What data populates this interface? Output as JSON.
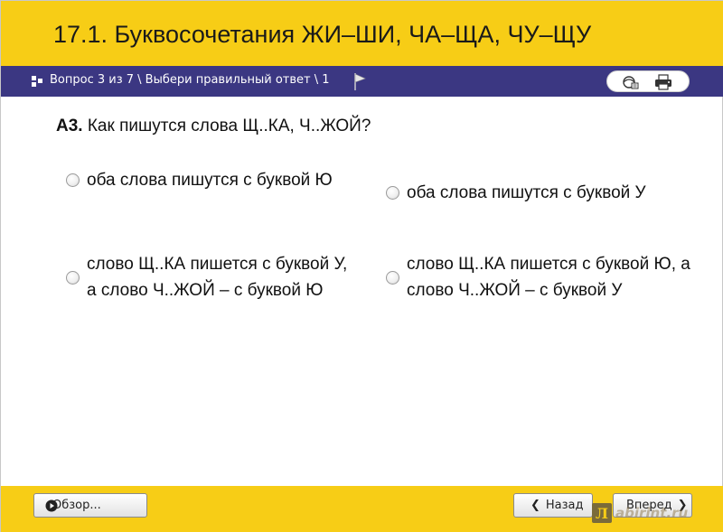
{
  "header": {
    "title": "17.1. Буквосочетания ЖИ–ШИ, ЧА–ЩА, ЧУ–ЩУ"
  },
  "nav": {
    "breadcrumb": "Вопрос 3 из 7 \\ Выбери правильный ответ \\ 1",
    "tools": [
      "help-icon",
      "print-icon"
    ]
  },
  "question": {
    "number": "А3.",
    "text": "Как пишутся слова Щ..КА, Ч..ЖОЙ?"
  },
  "options": [
    {
      "text": "оба слова пишутся с буквой Ю",
      "selected": false
    },
    {
      "text": "оба слова пишутся с буквой У",
      "selected": false
    },
    {
      "text": "слово Щ..КА пишется с буквой У, а слово Ч..ЖОЙ – с буквой Ю",
      "selected": false
    },
    {
      "text": "слово Щ..КА пишется с буквой Ю, а слово Ч..ЖОЙ – с буквой У",
      "selected": false
    }
  ],
  "footer": {
    "review_label": "Обзор...",
    "back_label": "Назад",
    "next_label": "Вперед",
    "back_chevron": "❮",
    "next_chevron": "❯"
  },
  "watermark": {
    "logo": "Л",
    "text": "abirint.ru"
  },
  "colors": {
    "header_bg": "#f7cd16",
    "nav_bg": "#3b3782",
    "footer_bg": "#f7cd16"
  }
}
